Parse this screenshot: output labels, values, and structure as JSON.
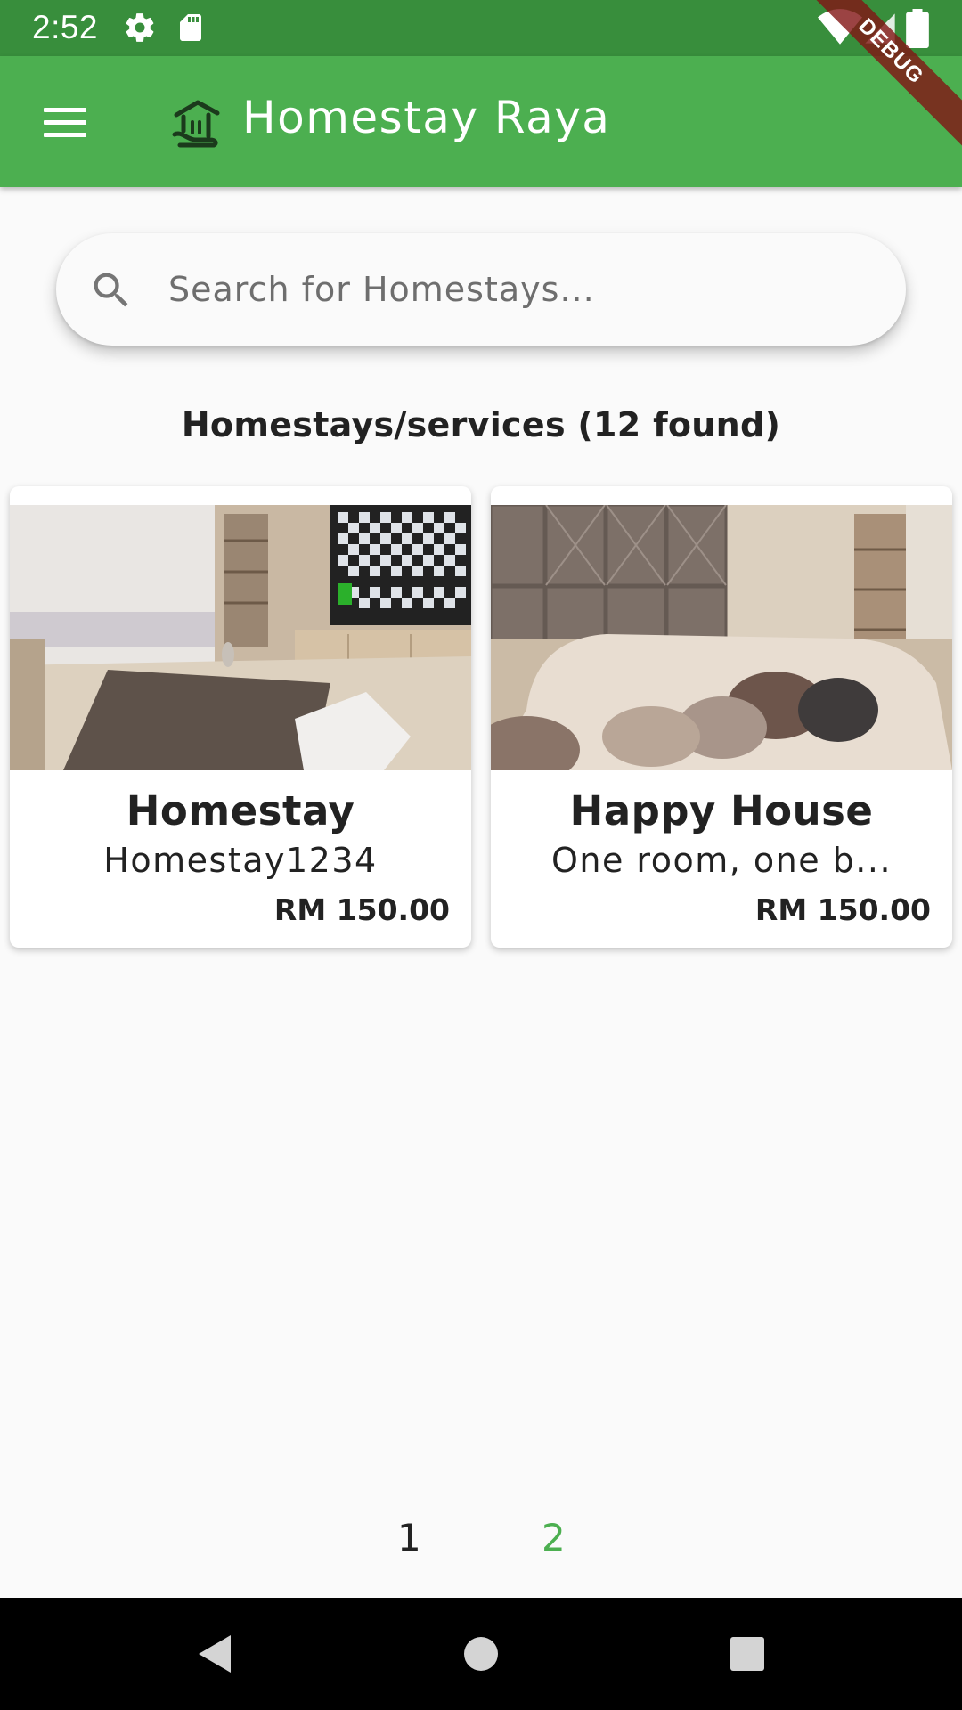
{
  "status_bar": {
    "time": "2:52",
    "icons": [
      "settings-icon",
      "sd-card-icon",
      "wifi-icon",
      "signal-icon",
      "battery-icon"
    ]
  },
  "debug_banner": "DEBUG",
  "app_bar": {
    "title": "Homestay Raya",
    "menu_icon": "menu-icon",
    "logo_icon": "house-logo-icon",
    "color": "#4caf50"
  },
  "search": {
    "placeholder": "Search for Homestays...",
    "value": ""
  },
  "results": {
    "count_label": "Homestays/services (12 found)"
  },
  "listings": [
    {
      "title": "Homestay",
      "description": "Homestay1234",
      "price": "RM 150.00"
    },
    {
      "title": "Happy House",
      "description": "One room, one b...",
      "price": "RM 150.00"
    }
  ],
  "pagination": {
    "pages": [
      "1",
      "2"
    ],
    "current": "2",
    "active_color": "#4caf50"
  },
  "nav_bar": {
    "icons": [
      "back-icon",
      "home-icon",
      "recents-icon"
    ]
  }
}
